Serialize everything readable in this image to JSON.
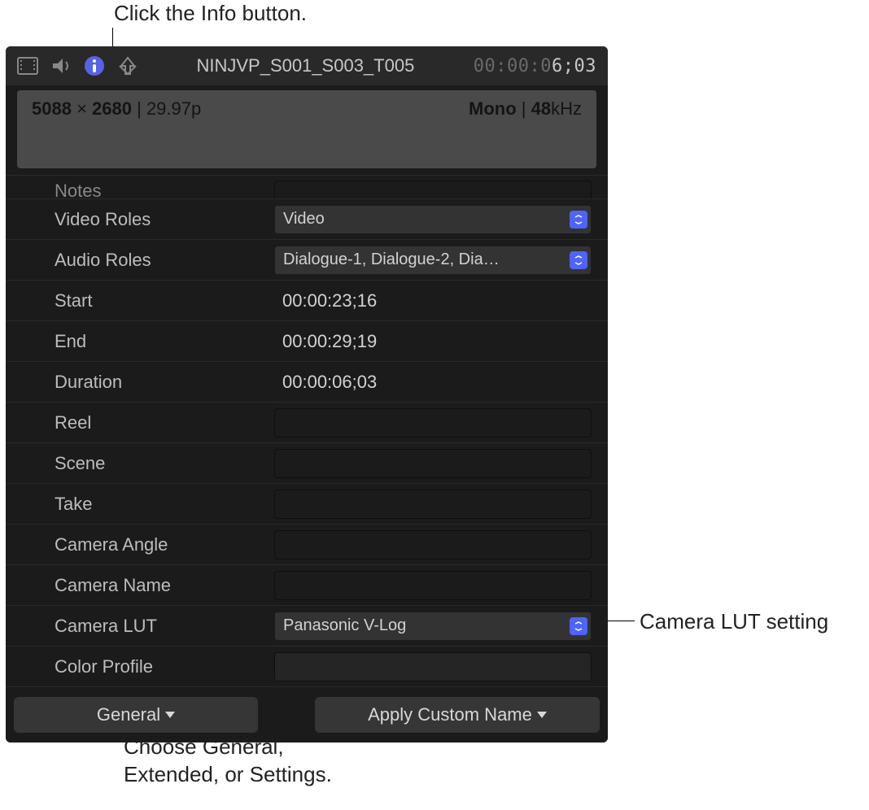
{
  "annotations": {
    "info_button": "Click the Info button.",
    "lut_setting": "Camera LUT setting",
    "view_menu": "Choose General, Extended, or Settings."
  },
  "toolbar": {
    "clip_title": "NINJVP_S001_S003_T005",
    "timecode_dim": "00:00:0",
    "timecode_bright": "6;03"
  },
  "format": {
    "resolution_w": "5088",
    "resolution_h": "2680",
    "framerate": "29.97p",
    "audio_channels": "Mono",
    "audio_rate_num": "48",
    "audio_rate_unit": "kHz"
  },
  "fields": {
    "notes": {
      "label": "Notes",
      "value": ""
    },
    "video_roles": {
      "label": "Video Roles",
      "value": "Video"
    },
    "audio_roles": {
      "label": "Audio Roles",
      "value": "Dialogue-1, Dialogue-2, Dia…"
    },
    "start": {
      "label": "Start",
      "value": "00:00:23;16"
    },
    "end": {
      "label": "End",
      "value": "00:00:29;19"
    },
    "duration": {
      "label": "Duration",
      "value": "00:00:06;03"
    },
    "reel": {
      "label": "Reel",
      "value": ""
    },
    "scene": {
      "label": "Scene",
      "value": ""
    },
    "take": {
      "label": "Take",
      "value": ""
    },
    "camera_angle": {
      "label": "Camera Angle",
      "value": ""
    },
    "camera_name": {
      "label": "Camera Name",
      "value": ""
    },
    "camera_lut": {
      "label": "Camera LUT",
      "value": "Panasonic V-Log"
    },
    "color_profile": {
      "label": "Color Profile",
      "value": ""
    }
  },
  "footer": {
    "view_menu": "General",
    "apply_name": "Apply Custom Name"
  }
}
